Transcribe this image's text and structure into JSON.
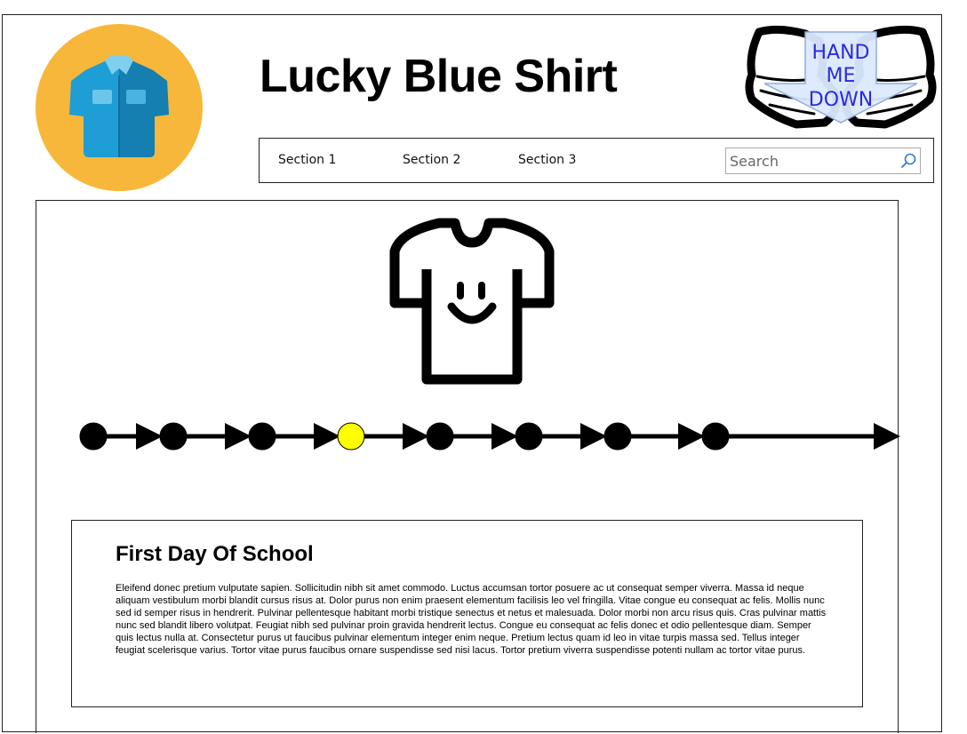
{
  "header": {
    "title": "Lucky Blue Shirt",
    "logo_icon": "shirt-icon",
    "badge": {
      "icon": "open-hands-icon",
      "lines": [
        "HAND",
        "ME",
        "DOWN"
      ]
    }
  },
  "nav": {
    "items": [
      {
        "label": "Section 1"
      },
      {
        "label": "Section 2"
      },
      {
        "label": "Section 3"
      }
    ],
    "search": {
      "placeholder": "Search",
      "value": ""
    }
  },
  "hero": {
    "icon": "smiling-tshirt-icon"
  },
  "timeline": {
    "node_count": 8,
    "active_index": 3,
    "colors": {
      "node": "#000000",
      "active": "#ffff00"
    }
  },
  "story": {
    "title": "First Day Of School",
    "body": "Eleifend donec pretium vulputate sapien. Sollicitudin nibh sit amet commodo. Luctus accumsan tortor posuere ac ut consequat semper viverra. Massa id neque aliquam vestibulum morbi blandit cursus risus at. Dolor purus non enim praesent elementum facilisis leo vel fringilla. Vitae congue eu consequat ac felis. Mollis nunc sed id semper risus in hendrerit. Pulvinar pellentesque habitant morbi tristique senectus et netus et malesuada. Dolor morbi non arcu risus quis. Cras pulvinar mattis nunc sed blandit libero volutpat. Feugiat nibh sed pulvinar proin gravida hendrerit lectus. Congue eu consequat ac felis donec et odio pellentesque diam. Semper quis lectus nulla at. Consectetur purus ut faucibus pulvinar elementum integer enim neque. Pretium lectus quam id leo in vitae turpis massa sed. Tellus integer feugiat scelerisque varius. Tortor vitae purus faucibus ornare suspendisse sed nisi lacus. Tortor pretium viverra suspendisse potenti nullam ac tortor vitae purus."
  },
  "colors": {
    "logo_bg": "#f7b73a",
    "shirt_blue": "#1e9ed4",
    "shirt_dark": "#147fb0",
    "badge_text": "#2a2ae0",
    "badge_arrow": "#dce9ff"
  }
}
